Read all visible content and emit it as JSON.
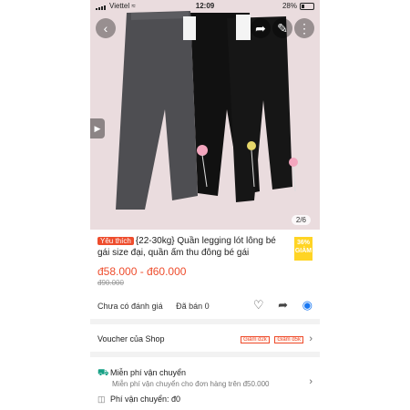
{
  "status_bar": {
    "carrier": "Viettel",
    "time": "12:09",
    "battery": "28%"
  },
  "image": {
    "page_indicator": "2/6"
  },
  "product": {
    "badge": "Yêu thích",
    "title": "{22-30kg} Quần legging lót lông bé gái size đại, quần ấm thu đông bé gái",
    "discount_percent": "36%",
    "discount_label": "GIẢM",
    "price": "đ58.000 - đ60.000",
    "old_price": "đ90.000",
    "rating": "Chưa có đánh giá",
    "sold": "Đã bán 0"
  },
  "voucher": {
    "label": "Voucher của Shop",
    "tags": [
      "Giảm đ2k",
      "Giảm đ5k"
    ]
  },
  "shipping": {
    "title": "Miễn phí vận chuyển",
    "subtitle": "Miễn phí vận chuyển cho đơn hàng trên đ50.000",
    "fee": "Phí vận chuyển: đ0"
  },
  "icons": [
    "wifi-icon",
    "back-icon",
    "share-icon",
    "cart-icon",
    "play-icon",
    "heart-icon",
    "messenger-icon",
    "chevron-right-icon",
    "truck-icon"
  ],
  "colors": {
    "accent": "#ee4d2d",
    "badge": "#ffd424"
  }
}
